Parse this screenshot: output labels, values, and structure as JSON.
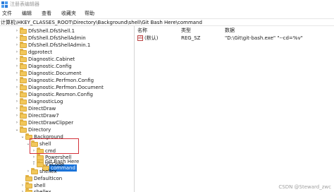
{
  "window": {
    "title": "注册表编辑器"
  },
  "menu": [
    "文件",
    "编辑",
    "查看",
    "收藏夹",
    "帮助"
  ],
  "address": "计算机\\HKEY_CLASSES_ROOT\\Directory\\Background\\shell\\Git Bash Here\\command",
  "tree": [
    {
      "label": "DfsShell.DfsShell.1",
      "expander": "›"
    },
    {
      "label": "DfsShell.DfsShellAdmin",
      "expander": "›"
    },
    {
      "label": "DfsShell.DfsShellAdmin.1",
      "expander": "›"
    },
    {
      "label": "dgprotect",
      "expander": "›"
    },
    {
      "label": "Diagnostic.Cabinet",
      "expander": "›"
    },
    {
      "label": "Diagnostic.Config",
      "expander": "›"
    },
    {
      "label": "Diagnostic.Document",
      "expander": "›"
    },
    {
      "label": "Diagnostic.Perfmon.Config",
      "expander": "›"
    },
    {
      "label": "Diagnostic.Perfmon.Document",
      "expander": "›"
    },
    {
      "label": "Diagnostic.Resmon.Config",
      "expander": "›"
    },
    {
      "label": "DiagnosticLog",
      "expander": "›"
    },
    {
      "label": "DirectDraw",
      "expander": "›"
    },
    {
      "label": "DirectDraw7",
      "expander": "›"
    },
    {
      "label": "DirectDrawClipper",
      "expander": "›"
    },
    {
      "label": "Directory",
      "expander": "⌄"
    },
    {
      "label": "Background",
      "expander": "⌄"
    },
    {
      "label": "shell",
      "expander": "⌄"
    },
    {
      "label": "cmd",
      "expander": "›"
    },
    {
      "label": "Git Bash Here",
      "expander": "⌄"
    },
    {
      "label": "command",
      "expander": ""
    },
    {
      "label": "Powershell",
      "expander": "›"
    },
    {
      "label": "VSCode",
      "expander": "›"
    },
    {
      "label": "shellex",
      "expander": "›"
    },
    {
      "label": "DefaultIcon",
      "expander": ""
    },
    {
      "label": "shell",
      "expander": "›"
    },
    {
      "label": "shellex",
      "expander": "›"
    }
  ],
  "values_pane": {
    "columns": [
      "名称",
      "类型",
      "数据"
    ],
    "rows": [
      {
        "icon": "ab",
        "name": "(默认)",
        "type": "REG_SZ",
        "data": "\"D:\\Git\\git-bash.exe\" \"--cd=%v\""
      }
    ]
  },
  "watermark": "CSDN @Steward_zwc",
  "colors": {
    "selection": "#1a73d9",
    "highlight_border": "#d3313a",
    "folder": "#f2c75a"
  }
}
